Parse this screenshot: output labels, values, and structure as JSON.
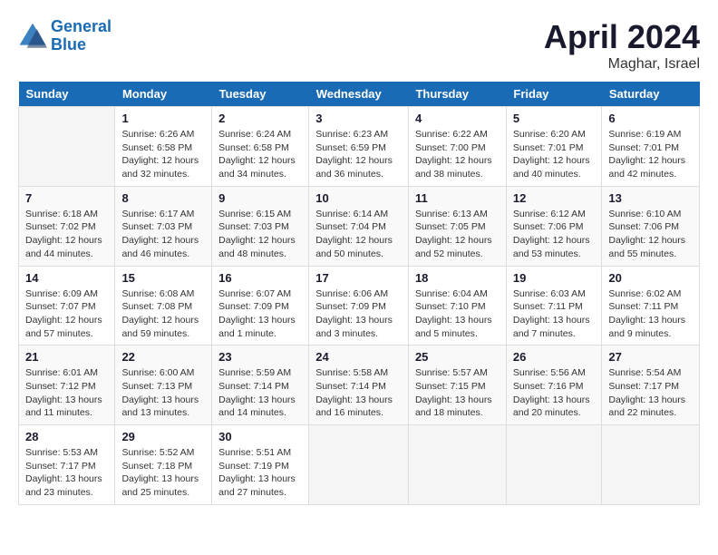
{
  "header": {
    "logo_line1": "General",
    "logo_line2": "Blue",
    "month_title": "April 2024",
    "location": "Maghar, Israel"
  },
  "days_of_week": [
    "Sunday",
    "Monday",
    "Tuesday",
    "Wednesday",
    "Thursday",
    "Friday",
    "Saturday"
  ],
  "weeks": [
    [
      {
        "day": "",
        "info": ""
      },
      {
        "day": "1",
        "info": "Sunrise: 6:26 AM\nSunset: 6:58 PM\nDaylight: 12 hours\nand 32 minutes."
      },
      {
        "day": "2",
        "info": "Sunrise: 6:24 AM\nSunset: 6:58 PM\nDaylight: 12 hours\nand 34 minutes."
      },
      {
        "day": "3",
        "info": "Sunrise: 6:23 AM\nSunset: 6:59 PM\nDaylight: 12 hours\nand 36 minutes."
      },
      {
        "day": "4",
        "info": "Sunrise: 6:22 AM\nSunset: 7:00 PM\nDaylight: 12 hours\nand 38 minutes."
      },
      {
        "day": "5",
        "info": "Sunrise: 6:20 AM\nSunset: 7:01 PM\nDaylight: 12 hours\nand 40 minutes."
      },
      {
        "day": "6",
        "info": "Sunrise: 6:19 AM\nSunset: 7:01 PM\nDaylight: 12 hours\nand 42 minutes."
      }
    ],
    [
      {
        "day": "7",
        "info": "Sunrise: 6:18 AM\nSunset: 7:02 PM\nDaylight: 12 hours\nand 44 minutes."
      },
      {
        "day": "8",
        "info": "Sunrise: 6:17 AM\nSunset: 7:03 PM\nDaylight: 12 hours\nand 46 minutes."
      },
      {
        "day": "9",
        "info": "Sunrise: 6:15 AM\nSunset: 7:03 PM\nDaylight: 12 hours\nand 48 minutes."
      },
      {
        "day": "10",
        "info": "Sunrise: 6:14 AM\nSunset: 7:04 PM\nDaylight: 12 hours\nand 50 minutes."
      },
      {
        "day": "11",
        "info": "Sunrise: 6:13 AM\nSunset: 7:05 PM\nDaylight: 12 hours\nand 52 minutes."
      },
      {
        "day": "12",
        "info": "Sunrise: 6:12 AM\nSunset: 7:06 PM\nDaylight: 12 hours\nand 53 minutes."
      },
      {
        "day": "13",
        "info": "Sunrise: 6:10 AM\nSunset: 7:06 PM\nDaylight: 12 hours\nand 55 minutes."
      }
    ],
    [
      {
        "day": "14",
        "info": "Sunrise: 6:09 AM\nSunset: 7:07 PM\nDaylight: 12 hours\nand 57 minutes."
      },
      {
        "day": "15",
        "info": "Sunrise: 6:08 AM\nSunset: 7:08 PM\nDaylight: 12 hours\nand 59 minutes."
      },
      {
        "day": "16",
        "info": "Sunrise: 6:07 AM\nSunset: 7:09 PM\nDaylight: 13 hours\nand 1 minute."
      },
      {
        "day": "17",
        "info": "Sunrise: 6:06 AM\nSunset: 7:09 PM\nDaylight: 13 hours\nand 3 minutes."
      },
      {
        "day": "18",
        "info": "Sunrise: 6:04 AM\nSunset: 7:10 PM\nDaylight: 13 hours\nand 5 minutes."
      },
      {
        "day": "19",
        "info": "Sunrise: 6:03 AM\nSunset: 7:11 PM\nDaylight: 13 hours\nand 7 minutes."
      },
      {
        "day": "20",
        "info": "Sunrise: 6:02 AM\nSunset: 7:11 PM\nDaylight: 13 hours\nand 9 minutes."
      }
    ],
    [
      {
        "day": "21",
        "info": "Sunrise: 6:01 AM\nSunset: 7:12 PM\nDaylight: 13 hours\nand 11 minutes."
      },
      {
        "day": "22",
        "info": "Sunrise: 6:00 AM\nSunset: 7:13 PM\nDaylight: 13 hours\nand 13 minutes."
      },
      {
        "day": "23",
        "info": "Sunrise: 5:59 AM\nSunset: 7:14 PM\nDaylight: 13 hours\nand 14 minutes."
      },
      {
        "day": "24",
        "info": "Sunrise: 5:58 AM\nSunset: 7:14 PM\nDaylight: 13 hours\nand 16 minutes."
      },
      {
        "day": "25",
        "info": "Sunrise: 5:57 AM\nSunset: 7:15 PM\nDaylight: 13 hours\nand 18 minutes."
      },
      {
        "day": "26",
        "info": "Sunrise: 5:56 AM\nSunset: 7:16 PM\nDaylight: 13 hours\nand 20 minutes."
      },
      {
        "day": "27",
        "info": "Sunrise: 5:54 AM\nSunset: 7:17 PM\nDaylight: 13 hours\nand 22 minutes."
      }
    ],
    [
      {
        "day": "28",
        "info": "Sunrise: 5:53 AM\nSunset: 7:17 PM\nDaylight: 13 hours\nand 23 minutes."
      },
      {
        "day": "29",
        "info": "Sunrise: 5:52 AM\nSunset: 7:18 PM\nDaylight: 13 hours\nand 25 minutes."
      },
      {
        "day": "30",
        "info": "Sunrise: 5:51 AM\nSunset: 7:19 PM\nDaylight: 13 hours\nand 27 minutes."
      },
      {
        "day": "",
        "info": ""
      },
      {
        "day": "",
        "info": ""
      },
      {
        "day": "",
        "info": ""
      },
      {
        "day": "",
        "info": ""
      }
    ]
  ]
}
